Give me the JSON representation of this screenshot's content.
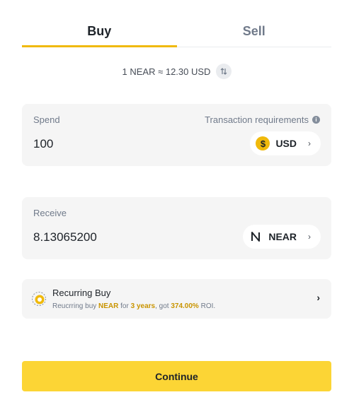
{
  "tabs": [
    {
      "label": "Buy",
      "active": true
    },
    {
      "label": "Sell",
      "active": false
    }
  ],
  "rate": {
    "text": "1 NEAR ≈ 12.30 USD",
    "swap_icon": "swap-vertical-icon"
  },
  "spend": {
    "label": "Spend",
    "requirements_label": "Transaction requirements",
    "amount": "100",
    "currency": "USD",
    "currency_icon": "$"
  },
  "receive": {
    "label": "Receive",
    "amount": "8.13065200",
    "currency": "NEAR"
  },
  "recurring": {
    "title": "Recurring Buy",
    "desc_prefix": "Reucrring buy ",
    "asset": "NEAR",
    "desc_mid": " for ",
    "period": "3 years",
    "desc_mid2": ", got ",
    "roi": "374.00%",
    "desc_suffix": " ROI."
  },
  "continue_label": "Continue",
  "colors": {
    "accent": "#f0b90b",
    "button": "#fcd535",
    "highlight": "#c99400",
    "card_bg": "#f5f5f5"
  }
}
